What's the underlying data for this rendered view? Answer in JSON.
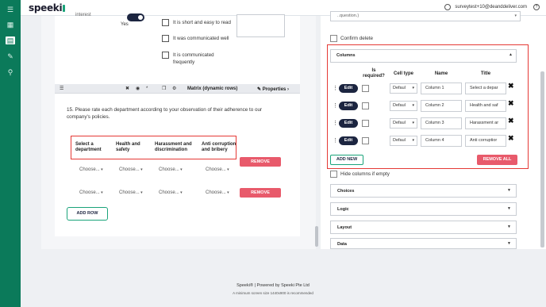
{
  "app": {
    "logo": "speeki",
    "user_email": "surveytest+10@deanddeliver.com"
  },
  "nav": [
    "menu-icon",
    "dashboard-icon",
    "survey-icon",
    "edit-icon",
    "search-icon"
  ],
  "top_question": {
    "radio_fragment": "interest",
    "yes_label": "Yes",
    "options": [
      "It is short and easy to read",
      "It was communicated well",
      "It is communicated frequently"
    ]
  },
  "toolbar": {
    "title": "Matrix (dynamic rows)",
    "properties": "Properties"
  },
  "question": {
    "text": "15.  Please rate each department according to your observation of their adherence to our company's policies.",
    "columns": [
      "Select a department",
      "Health and safety",
      "Harassment and discrimination",
      "Anti corruption and bribery"
    ],
    "rows": [
      {
        "cells": [
          "Choose...",
          "Choose...",
          "Choose...",
          "Choose..."
        ],
        "remove": "REMOVE"
      },
      {
        "cells": [
          "Choose...",
          "Choose...",
          "Choose...",
          "Choose..."
        ],
        "remove": "REMOVE"
      }
    ],
    "add_row": "ADD ROW"
  },
  "panel": {
    "select_value": "..question.)",
    "confirm_delete": "Confirm delete",
    "columns_title": "Columns",
    "grid_headers": {
      "required": "Is required?",
      "cell_type": "Cell type",
      "name": "Name",
      "title": "Title"
    },
    "column_rows": [
      {
        "edit": "Edit",
        "type": "Defaul",
        "name": "Column 1",
        "title": "Select a depar"
      },
      {
        "edit": "Edit",
        "type": "Defaul",
        "name": "Column 2",
        "title": "Health and saf"
      },
      {
        "edit": "Edit",
        "type": "Defaul",
        "name": "Column 3",
        "title": "Harassment ar"
      },
      {
        "edit": "Edit",
        "type": "Defaul",
        "name": "Column 4",
        "title": "Anti corruptior"
      }
    ],
    "add_new": "ADD NEW",
    "remove_all": "REMOVE ALL",
    "hide_columns": "Hide columns if empty",
    "sections": [
      "Choices",
      "Logic",
      "Layout",
      "Data"
    ]
  },
  "footer": {
    "line1": "Speeki® | Powered by Speeki Pte Ltd",
    "line2": "A minimum screen size 1440x900 is recommended"
  }
}
